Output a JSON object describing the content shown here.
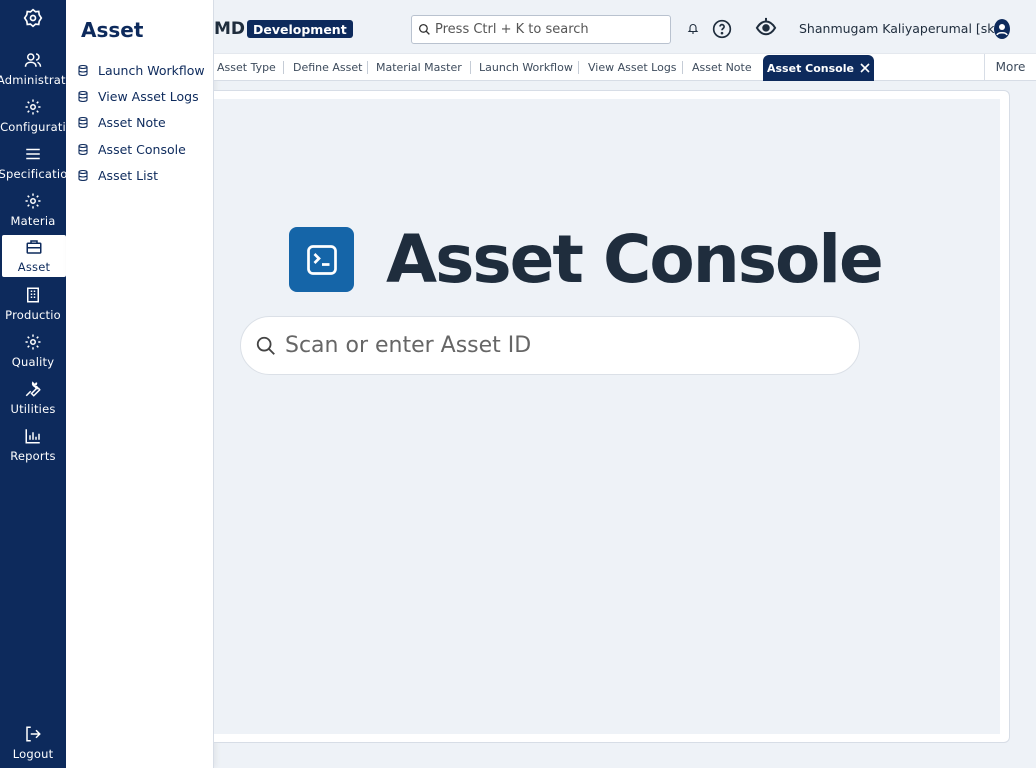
{
  "rail": {
    "items": [
      {
        "label": "Administrati",
        "icon": "users-icon"
      },
      {
        "label": "Configurati",
        "icon": "gear-icon"
      },
      {
        "label": "Specificatio",
        "icon": "list-icon"
      },
      {
        "label": "Materia",
        "icon": "gear-icon"
      },
      {
        "label": "Asset",
        "icon": "asset-icon"
      },
      {
        "label": "Productio",
        "icon": "building-icon"
      },
      {
        "label": "Quality",
        "icon": "gear-icon"
      },
      {
        "label": "Utilities",
        "icon": "wrench-icon"
      },
      {
        "label": "Reports",
        "icon": "bar-chart-icon"
      }
    ],
    "logout": "Logout"
  },
  "flyout": {
    "title": "Asset",
    "items": [
      "Launch Workflow",
      "View Asset Logs",
      "Asset Note",
      "Asset Console",
      "Asset List"
    ]
  },
  "header": {
    "app_name": "MD",
    "env_badge": "Development",
    "search_placeholder": "Press Ctrl + K to search",
    "user_name": "Shanmugam Kaliyaperumal [sk]"
  },
  "tabs": {
    "items": [
      "Asset Type",
      "Define Asset",
      "Material Master",
      "Launch Workflow",
      "View Asset Logs",
      "Asset Note"
    ],
    "active": "Asset Console",
    "more": "More"
  },
  "console": {
    "title": "Asset Console",
    "input_placeholder": "Scan or enter Asset ID"
  },
  "colors": {
    "navy": "#0d2a5c",
    "accent": "#1565a8",
    "background": "#eef2f7"
  }
}
